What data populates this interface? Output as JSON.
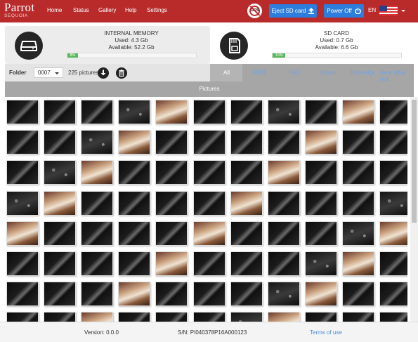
{
  "brand": {
    "title": "Parrot",
    "subtitle": "SEQUOIA"
  },
  "nav": {
    "items": [
      "Home",
      "Status",
      "Gallery",
      "Help",
      "Settings"
    ]
  },
  "header_actions": {
    "gps_icon_text": "GPS",
    "eject_label": "Eject SD card",
    "power_label": "Power Off",
    "language": "EN"
  },
  "internal_memory": {
    "title": "INTERNAL MEMORY",
    "used": "Used: 4.3 Gb",
    "available": "Available: 52.2 Gb",
    "percent_label": "8%",
    "percent": 8
  },
  "sd_card": {
    "title": "SD CARD",
    "used": "Used: 0.7 Gb",
    "available": "Available: 6.6 Gb",
    "percent_label": "10%",
    "percent": 10
  },
  "folder": {
    "label": "Folder",
    "value": "0007",
    "count": "225 pictures"
  },
  "filters": {
    "items": [
      "All",
      "RGB",
      "Red",
      "Green",
      "Red-edge",
      "Near infra-red"
    ],
    "active": "All"
  },
  "pictures_header": "Pictures",
  "gallery": {
    "columns": 11,
    "rows": [
      [
        "dark",
        "dark",
        "dark",
        "noise",
        "color",
        "dark",
        "dark",
        "noise",
        "dark",
        "color",
        "dark"
      ],
      [
        "dark",
        "dark",
        "noise",
        "color",
        "dark",
        "dark",
        "dark",
        "dark",
        "color",
        "dark",
        "dark"
      ],
      [
        "dark",
        "noise",
        "color",
        "dark",
        "dark",
        "dark",
        "dark",
        "color",
        "dark",
        "dark",
        "dark"
      ],
      [
        "noise",
        "color",
        "dark",
        "dark",
        "dark",
        "dark",
        "color",
        "dark",
        "dark",
        "dark",
        "noise"
      ],
      [
        "color",
        "dark",
        "dark",
        "dark",
        "dark",
        "color",
        "dark",
        "dark",
        "dark",
        "noise",
        "color"
      ],
      [
        "dark",
        "dark",
        "dark",
        "dark",
        "color",
        "dark",
        "dark",
        "dark",
        "noise",
        "color",
        "dark"
      ],
      [
        "dark",
        "dark",
        "dark",
        "color",
        "dark",
        "dark",
        "dark",
        "noise",
        "color",
        "dark",
        "dark"
      ],
      [
        "dark",
        "dark",
        "color",
        "dark",
        "dark",
        "dark",
        "noise",
        "color",
        "dark",
        "dark",
        "dark"
      ]
    ]
  },
  "footer": {
    "version": "Version: 0.0.0",
    "serial": "S/N: PI040378P16A000123",
    "terms": "Terms of use"
  },
  "colors": {
    "navbar": "#b92b2b",
    "button_blue": "#2d7ddc",
    "progress_green": "#5cb85c",
    "filter_bar": "#a6a6a6",
    "link_blue": "#4a8cd6"
  }
}
